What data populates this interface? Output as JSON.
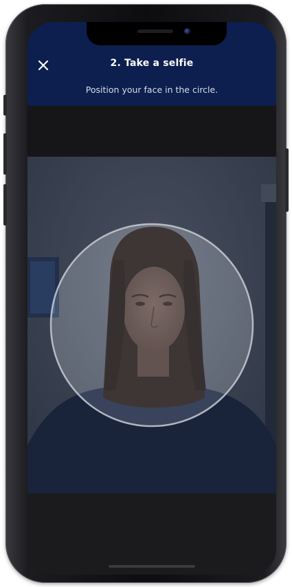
{
  "header": {
    "title": "2. Take a selfie",
    "subtitle": "Position your face in the circle.",
    "close_icon": "close-icon"
  },
  "colors": {
    "header_bg": "#0d1f4e",
    "title_text": "#ffffff",
    "subtitle_text": "#d8def0",
    "screen_bg": "#1c1c1e"
  },
  "camera": {
    "overlay_shape": "face-guide-circle"
  }
}
